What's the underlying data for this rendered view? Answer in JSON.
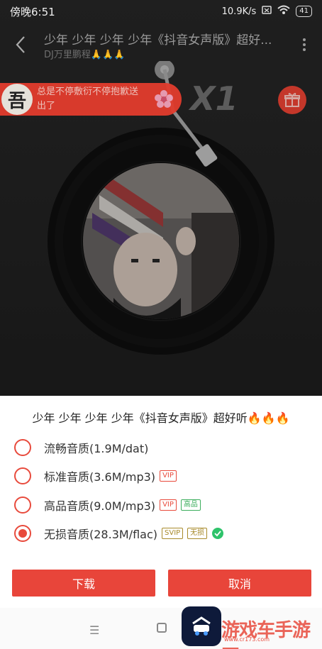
{
  "status": {
    "time": "傍晚6:51",
    "speed": "10.9K/s",
    "battery": "41"
  },
  "header": {
    "title": "少年 少年 少年 少年《抖音女声版》超好...",
    "subtitle": "DJ万里鹏程🙏🙏🙏"
  },
  "comment": {
    "avatar_char": "吾",
    "text": "总是不停敷衍不停抱歉送出了"
  },
  "gift": {
    "multiplier": "X1"
  },
  "sheet": {
    "title": "少年 少年 少年 少年《抖音女声版》超好听🔥🔥🔥",
    "options": [
      {
        "label": "流畅音质(1.9M/dat)",
        "selected": false,
        "tags": []
      },
      {
        "label": "标准音质(3.6M/mp3)",
        "selected": false,
        "tags": [
          "VIP"
        ]
      },
      {
        "label": "高品音质(9.0M/mp3)",
        "selected": false,
        "tags": [
          "VIP",
          "高品"
        ]
      },
      {
        "label": "无损音质(28.3M/flac)",
        "selected": true,
        "tags": [
          "SVIP",
          "无损"
        ]
      }
    ],
    "download_label": "下载",
    "cancel_label": "取消"
  },
  "watermark": {
    "text": "游戏车手游网",
    "url": "www.cr173.com"
  },
  "colors": {
    "accent": "#e8453a",
    "check": "#2ec36a"
  }
}
